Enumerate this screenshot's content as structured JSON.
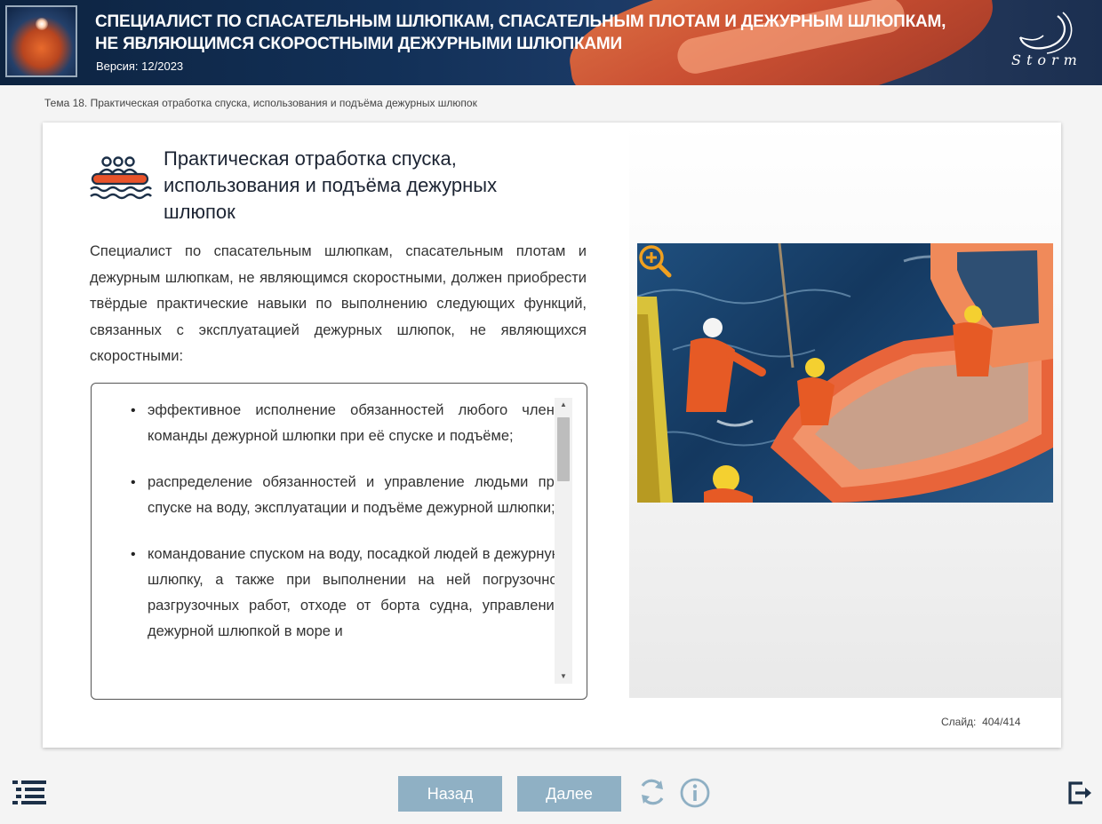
{
  "header": {
    "title_line1": "СПЕЦИАЛИСТ ПО СПАСАТЕЛЬНЫМ ШЛЮПКАМ, СПАСАТЕЛЬНЫМ ПЛОТАМ И ДЕЖУРНЫМ ШЛЮПКАМ,",
    "title_line2": "НЕ ЯВЛЯЮЩИМСЯ СКОРОСТНЫМИ ДЕЖУРНЫМИ ШЛЮПКАМИ",
    "version": "Версия: 12/2023",
    "logo_text": "Storm"
  },
  "breadcrumb": "Тема 18. Практическая отработка спуска, использования и подъёма дежурных шлюпок",
  "slide": {
    "title": "Практическая отработка спуска, использования и подъёма дежурных шлюпок",
    "intro": "Специалист по спасательным шлюпкам, спасательным плотам и дежурным шлюпкам, не являющимся скоростными, должен приобрести твёрдые практические навыки по выполнению следующих функций, связанных с эксплуатацией дежурных шлюпок, не являющихся скоростными:",
    "items": [
      "эффективное исполнение обязанностей любого члена команды дежурной шлюпки при её спуске и подъёме;",
      "распределение обязанностей и управление людьми при спуске на воду, эксплуатации и подъёме дежурной шлюпки;",
      "командование спуском на воду, посадкой людей в дежурную шлюпку, а также при выполнении на ней погрузочно-разгрузочных работ, отходе от борта судна, управлении дежурной шлюпкой в море и"
    ]
  },
  "counter": {
    "label": "Слайд:",
    "current": "404",
    "separator": "/",
    "total": "414"
  },
  "nav": {
    "back_label": "Назад",
    "next_label": "Далее"
  },
  "icons": {
    "title": "rescue-boat-icon",
    "zoom": "zoom-in-icon",
    "menu": "list-menu-icon",
    "reload": "reload-icon",
    "info": "info-icon",
    "exit": "exit-icon"
  },
  "colors": {
    "accent": "#e8532a",
    "button": "#8fb0c4",
    "zoom": "#f0a020",
    "header_bg": "#123057",
    "icon_navy": "#1c3048"
  }
}
